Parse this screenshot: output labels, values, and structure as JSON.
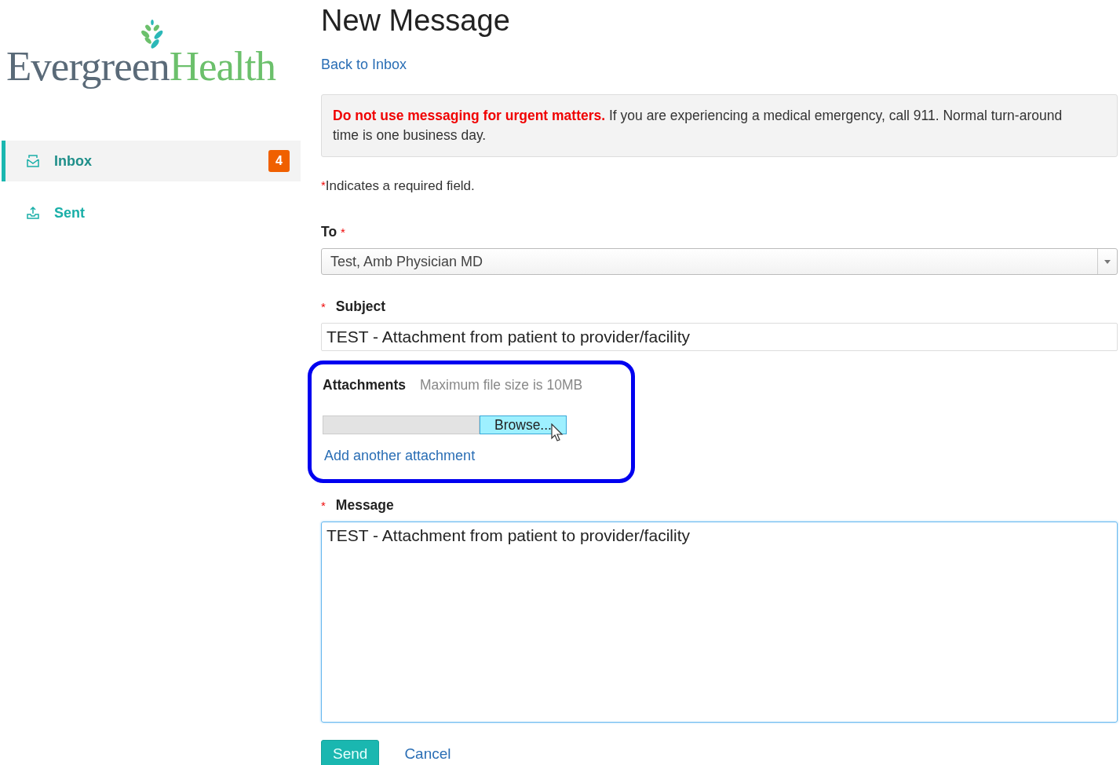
{
  "logo": {
    "first": "Evergreen",
    "second": "Health"
  },
  "sidebar": {
    "items": [
      {
        "label": "Inbox",
        "kind": "inbox",
        "selected": true,
        "badge": "4"
      },
      {
        "label": "Sent",
        "kind": "sent",
        "selected": false
      }
    ]
  },
  "title": "New Message",
  "back_link": "Back to Inbox",
  "notice": "**Do not use messaging for urgent matters.** If you are experiencing a medical emergency, call 911. Normal turn-around time is one business day.",
  "required_note": {
    "mark": "*",
    "text": "Indicates a required field."
  },
  "to": {
    "label": "To",
    "required_mark": "*",
    "mark_first": false,
    "value": "Test, Amb Physician MD"
  },
  "subject": {
    "label": "Subject",
    "required_mark": "*",
    "mark_first": true,
    "value": "TEST - Attachment from patient to provider/facility"
  },
  "attachments": {
    "label": "Attachments",
    "hint": "Maximum file size is 10MB",
    "browse": "Browse...",
    "add_link": "Add another attachment",
    "highlighted": true
  },
  "message": {
    "label": "Message",
    "required_mark": "*",
    "mark_first": true,
    "value": "TEST - Attachment from patient to provider/facility"
  },
  "buttons": {
    "send": "Send",
    "cancel": "Cancel"
  }
}
